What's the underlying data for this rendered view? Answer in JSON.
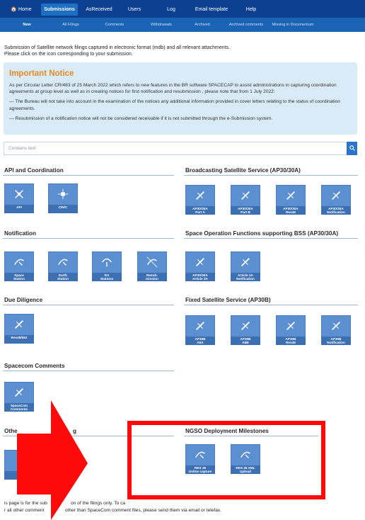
{
  "nav": {
    "top": [
      {
        "label": "🏠 Home"
      },
      {
        "label": "Submissions"
      },
      {
        "label": "AsReceived"
      },
      {
        "label": "Users"
      },
      {
        "label": "Log"
      },
      {
        "label": "Email template"
      },
      {
        "label": "Help"
      }
    ],
    "sub": [
      {
        "label": "New"
      },
      {
        "label": "All Filings"
      },
      {
        "label": "Comments"
      },
      {
        "label": "Withdrawals"
      },
      {
        "label": "Archived"
      },
      {
        "label": "Archived comments"
      },
      {
        "label": "Missing in Documentum"
      }
    ]
  },
  "intro": {
    "line1": "Submission of Satellite network filings captured in electronic format (mdb) and all relevant attachments.",
    "line2": "Please click on the icon corresponding to your submission."
  },
  "notice": {
    "title": "Important Notice",
    "p1": "As per Circular Letter CR/483 of 25 March 2022 which refers to new features in the BR software SPACECAP to assist administrations in capturing coordination agreements at group level as well as in creating notices for first notification and resubmission , please note that from 1 July 2022:",
    "p2": "— The Bureau will not take into account in the examination of the notices any additional information provided in cover letters relating to the status of coordination agreements.",
    "p3": "— Resubmission of a notification notice will not be considered receivable if it is not submitted through the e-Submission system."
  },
  "search": {
    "placeholder": "Contains text"
  },
  "sections": {
    "api": {
      "title": "API and Coordination",
      "tiles": [
        {
          "label": "API"
        },
        {
          "label": "C/N/C"
        }
      ]
    },
    "bss": {
      "title": "Broadcasting Satellite Service (AP30/30A)",
      "tiles": [
        {
          "label": "AP30/30A\nPart A"
        },
        {
          "label": "AP30/30A\nPart B"
        },
        {
          "label": "AP30/30A\nRes49"
        },
        {
          "label": "AP30/30A\nNotification"
        }
      ]
    },
    "notif": {
      "title": "Notification",
      "tiles": [
        {
          "label": "Space\nStation"
        },
        {
          "label": "Earth\nStation"
        },
        {
          "label": "RA\nStations"
        },
        {
          "label": "Resub-\nmission"
        }
      ]
    },
    "sof": {
      "title": "Space Operation Functions supporting BSS (AP30/30A)",
      "tiles": [
        {
          "label": "AP30/30A\nArticle 2A"
        },
        {
          "label": "Article 2A\nNotification"
        }
      ]
    },
    "dd": {
      "title": "Due Diligence",
      "tiles": [
        {
          "label": "Res49/552"
        }
      ]
    },
    "fss": {
      "title": "Fixed Satellite Service (AP30B)",
      "tiles": [
        {
          "label": "AP30B\nA6A"
        },
        {
          "label": "AP30B\nA6B"
        },
        {
          "label": "AP30B\nRes49"
        },
        {
          "label": "AP30B\nNotification"
        }
      ]
    },
    "sc": {
      "title": "Spacecom Comments",
      "tiles": [
        {
          "label": "SpaceCom\nComments"
        }
      ]
    },
    "other": {
      "title_start": "Othe",
      "title_end": "g",
      "tiles": [
        {
          "label": "Ot"
        }
      ]
    },
    "ngso": {
      "title": "NGSO Deployment Milestones",
      "tiles": [
        {
          "label": "RES 35\nOnline capture"
        },
        {
          "label": "RES 35 XML\nUpload"
        }
      ]
    }
  },
  "footer": {
    "line1_a": "is page is for the sub",
    "line1_b": "on of the filings only. To ca",
    "line2_a": "r all other comment",
    "line2_b": "other than SpaceCom comment files, please send them via email or telefax."
  },
  "colors": {
    "nav": "#0b3f8f",
    "tile": "#5b8fd0",
    "highlight": "#ff0a0a",
    "notice_title": "#e58a28"
  }
}
